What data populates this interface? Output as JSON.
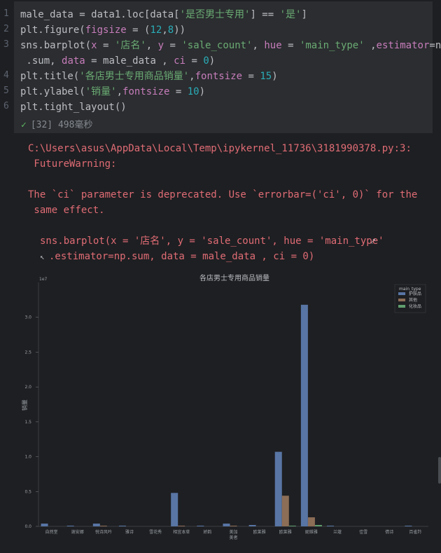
{
  "code": {
    "line_numbers": [
      "1",
      "2",
      "3",
      "4",
      "5",
      "6"
    ],
    "line1": [
      "male_data = data1.loc[data[",
      "'是否男士专用'",
      "] == ",
      "'是'",
      "]"
    ],
    "line2": [
      "plt.figure(",
      "figsize",
      " = (",
      "12",
      ",",
      "8",
      "))"
    ],
    "line3": [
      "sns.barplot(",
      "x",
      " = ",
      "'店名'",
      ", ",
      "y",
      " = ",
      "'sale_count'",
      ", ",
      "hue",
      " = ",
      "'main_type'",
      " ,",
      "estimator",
      "=np"
    ],
    "line3b": [
      " .sum, ",
      "data",
      " = male_data , ",
      "ci",
      " = ",
      "0",
      ")"
    ],
    "line4": [
      "plt.title(",
      "'各店男士专用商品销量'",
      ",",
      "fontsize",
      " = ",
      "15",
      ")"
    ],
    "line5": [
      "plt.ylabel(",
      "'销量'",
      ",",
      "fontsize",
      " = ",
      "10",
      ")"
    ],
    "line6": "plt.tight_layout()",
    "exec_info": "[32] 498毫秒"
  },
  "output": {
    "warn_path": "C:\\Users\\asus\\AppData\\Local\\Temp\\ipykernel_11736\\3181990378.py:3:",
    "warn_type": " FutureWarning:",
    "msg1": "The `ci` parameter is deprecated. Use `errorbar=('ci', 0)` for the",
    "msg2": " same effect.",
    "src1": "sns.barplot(x = '店名', y = 'sale_count', hue = 'main_type'",
    "src2": ".estimator=np.sum, data = male_data , ci = 0)"
  },
  "chart_data": {
    "type": "bar",
    "title": "各店男士专用商品销量",
    "xlabel": "",
    "ylabel": "销量",
    "y_scale_label": "1e7",
    "ylim": [
      0,
      3.5
    ],
    "yticks": [
      "0.0",
      "0.5",
      "1.0",
      "1.5",
      "2.0",
      "2.5",
      "3.0"
    ],
    "categories": [
      "自然堂",
      "谢安娜",
      "悦诗风吟",
      "雅诗",
      "雪花秀",
      "相宜本草",
      "娇韵",
      "美加 美者",
      "欧莱雅",
      "欧莱雅",
      "妮维雅",
      "兰蔻",
      "佳雪",
      "倩诗",
      "百雀羚"
    ],
    "legend_title": "main_type",
    "series": [
      {
        "name": "护肤品",
        "color": "#5875a4",
        "values": [
          0.04,
          0.01,
          0.04,
          0.01,
          0.0,
          0.48,
          0.01,
          0.04,
          0.02,
          1.07,
          3.18,
          0.01,
          0.0,
          0.0,
          0.01
        ]
      },
      {
        "name": "其他",
        "color": "#8c6d56",
        "values": [
          0.0,
          0.0,
          0.01,
          0.0,
          0.0,
          0.01,
          0.0,
          0.01,
          0.0,
          0.44,
          0.13,
          0.0,
          0.0,
          0.0,
          0.0
        ]
      },
      {
        "name": "化妆品",
        "color": "#5f9e6e",
        "values": [
          0.0,
          0.0,
          0.0,
          0.0,
          0.0,
          0.0,
          0.0,
          0.0,
          0.0,
          0.01,
          0.02,
          0.0,
          0.0,
          0.0,
          0.0
        ]
      }
    ],
    "grid": false,
    "legend_position": "top-right"
  }
}
